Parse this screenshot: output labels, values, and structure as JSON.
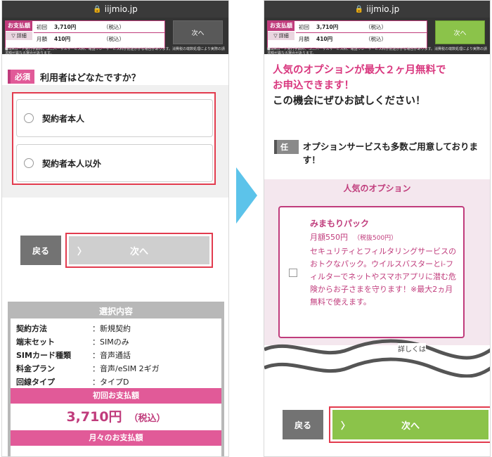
{
  "browser": {
    "domain": "iijmio.jp"
  },
  "paybar": {
    "tag": "お支払額",
    "detail": "詳細",
    "first_label": "初回",
    "first_value": "3,710円",
    "first_tax": "（税込）",
    "monthly_label": "月額",
    "monthly_value": "410円",
    "monthly_tax": "（税込）",
    "next_label": "次へ",
    "note": "■SIMカード発行手数料、ユニバーサルサービス料、電話リレーサービス料が別途かかる場合があります。消費税の端数処理により実際の請求額が異なる場合があります。"
  },
  "left": {
    "required_badge": "必須",
    "question": "利用者はどなたですか？",
    "choices": [
      "契約者本人",
      "契約者本人以外"
    ],
    "back_label": "戻る",
    "next_label": "次へ",
    "summary": {
      "title": "選択内容",
      "rows": [
        {
          "k": "契約方法",
          "v": "：新規契約"
        },
        {
          "k": "端末セット",
          "v": "：SIMのみ"
        },
        {
          "k": "SIMカード種類",
          "v": "：音声通話"
        },
        {
          "k": "料金プラン",
          "v": "：音声/eSIM 2ギガ"
        },
        {
          "k": "回線タイプ",
          "v": "：タイプD"
        }
      ],
      "first_head": "初回お支払額",
      "first_amount": "3,710円",
      "first_tax": "（税込）",
      "monthly_head": "月々のお支払額"
    }
  },
  "right": {
    "promo_line1": "人気のオプションが最大２ヶ月無料で",
    "promo_line2": "お申込できます！",
    "promo_line3": "この機会にぜひお試しください！",
    "optional_badge": "任意",
    "options_text": "オプションサービスも多数ご用意しております！",
    "popular_head": "人気のオプション",
    "option": {
      "name": "みまもりパック",
      "price": "月額550円",
      "price_ex": "（税抜500円）",
      "desc": "セキュリティとフィルタリングサービスのおトクなパック。ウイルスバスターとi-フィルターでネットやスマホアプリに潜む危険からお子さまを守ります！※最大2ヵ月無料で使えます。"
    },
    "more_link": "詳しくは",
    "back_label": "戻る",
    "next_label": "次へ"
  },
  "colors": {
    "accent_pink": "#c03c7c",
    "highlight_red": "#e23b4e",
    "green": "#8bc34a",
    "arrow_blue": "#5cc3ea"
  }
}
